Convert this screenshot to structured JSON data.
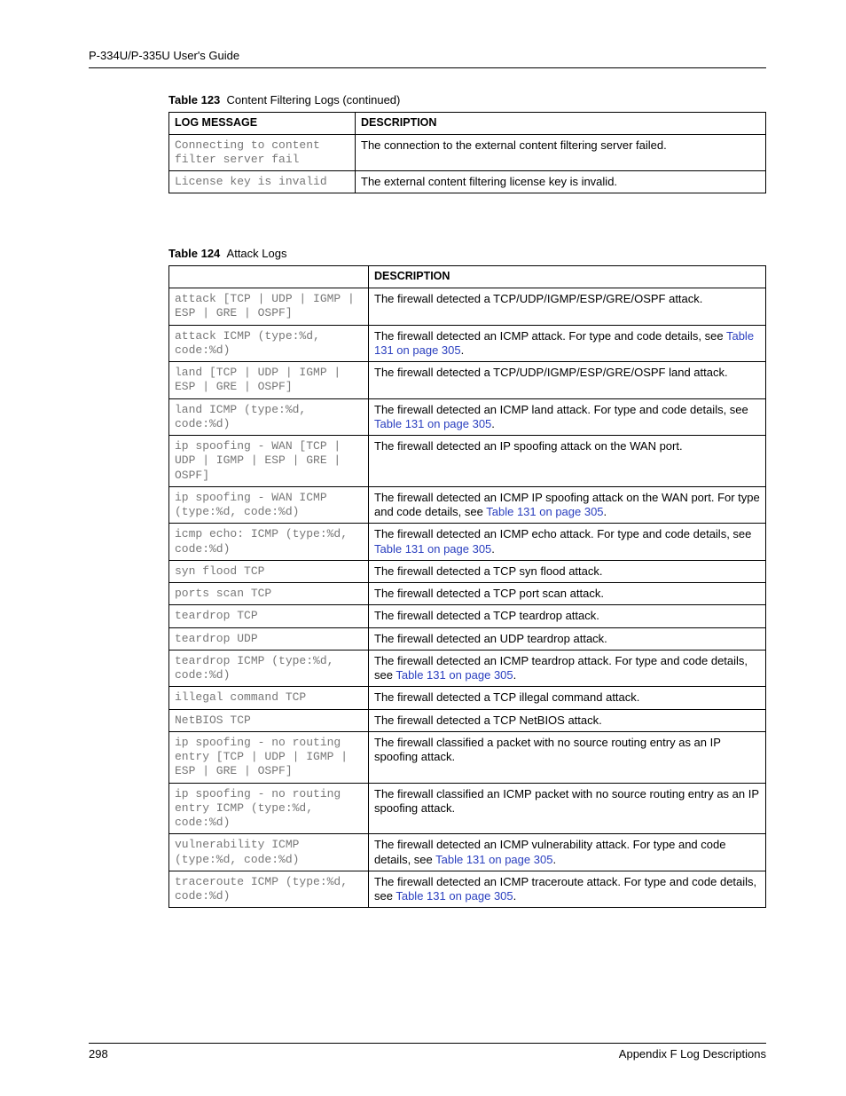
{
  "runningHead": "P-334U/P-335U User's Guide",
  "table123": {
    "caption_prefix": "Table 123",
    "caption_text": "Content Filtering Logs (continued)",
    "headers": {
      "log": "LOG MESSAGE",
      "desc": "DESCRIPTION"
    },
    "rows": [
      {
        "log": "Connecting to content filter server fail",
        "desc": "The connection to the external content filtering server failed."
      },
      {
        "log": "License key is invalid",
        "desc": "The external content filtering license key is invalid."
      }
    ]
  },
  "table124": {
    "caption_prefix": "Table 124",
    "caption_text": "Attack Logs",
    "headers": {
      "log": "",
      "desc": "DESCRIPTION"
    },
    "xref_text": "Table 131 on page 305",
    "rows": [
      {
        "log": "attack [TCP | UDP | IGMP | ESP | GRE | OSPF]",
        "desc_pre": "The firewall detected a TCP/UDP/IGMP/ESP/GRE/OSPF attack.",
        "xref": false
      },
      {
        "log": "attack ICMP (type:%d, code:%d)",
        "desc_pre": "The firewall detected an ICMP attack. For type and code details, see ",
        "xref": true,
        "desc_post": "."
      },
      {
        "log": "land [TCP | UDP | IGMP | ESP | GRE | OSPF]",
        "desc_pre": "The firewall detected a TCP/UDP/IGMP/ESP/GRE/OSPF land attack.",
        "xref": false
      },
      {
        "log": "land ICMP (type:%d, code:%d)",
        "desc_pre": "The firewall detected an ICMP land attack. For type and code details, see ",
        "xref": true,
        "desc_post": "."
      },
      {
        "log": "ip spoofing - WAN [TCP | UDP | IGMP | ESP | GRE | OSPF]",
        "desc_pre": "The firewall detected an IP spoofing attack on the WAN port.",
        "xref": false
      },
      {
        "log": "ip spoofing - WAN ICMP (type:%d, code:%d)",
        "desc_pre": "The firewall detected an ICMP IP spoofing attack on the WAN port. For type and code details, see ",
        "xref": true,
        "desc_post": "."
      },
      {
        "log": "icmp echo: ICMP (type:%d, code:%d)",
        "desc_pre": "The firewall detected an ICMP echo attack. For type and code details, see ",
        "xref": true,
        "desc_post": "."
      },
      {
        "log": "syn flood TCP",
        "desc_pre": "The firewall detected a TCP syn flood attack.",
        "xref": false
      },
      {
        "log": "ports scan TCP",
        "desc_pre": "The firewall detected a TCP port scan attack.",
        "xref": false
      },
      {
        "log": "teardrop TCP",
        "desc_pre": "The firewall detected a TCP teardrop attack.",
        "xref": false
      },
      {
        "log": "teardrop UDP",
        "desc_pre": "The firewall detected an UDP teardrop attack.",
        "xref": false
      },
      {
        "log": "teardrop ICMP (type:%d, code:%d)",
        "desc_pre": "The firewall detected an ICMP teardrop attack. For type and code details, see ",
        "xref": true,
        "desc_post": "."
      },
      {
        "log": "illegal command TCP",
        "desc_pre": "The firewall detected a TCP illegal command attack.",
        "xref": false
      },
      {
        "log": "NetBIOS TCP",
        "desc_pre": "The firewall detected a TCP NetBIOS attack.",
        "xref": false
      },
      {
        "log": "ip spoofing - no routing entry [TCP | UDP | IGMP | ESP | GRE | OSPF]",
        "desc_pre": "The firewall classified a packet with no source routing entry as an IP spoofing attack.",
        "xref": false
      },
      {
        "log": "ip spoofing - no routing entry ICMP (type:%d, code:%d)",
        "desc_pre": "The firewall classified an ICMP packet with no source routing entry as an IP spoofing attack.",
        "xref": false
      },
      {
        "log": "vulnerability ICMP (type:%d, code:%d)",
        "desc_pre": "The firewall detected an ICMP vulnerability attack. For type and code details, see ",
        "xref": true,
        "desc_post": "."
      },
      {
        "log": "traceroute ICMP (type:%d, code:%d)",
        "desc_pre": "The firewall detected an ICMP traceroute attack. For type and code details, see ",
        "xref": true,
        "desc_post": "."
      }
    ]
  },
  "footer": {
    "pageNumber": "298",
    "section": "Appendix F Log Descriptions"
  }
}
